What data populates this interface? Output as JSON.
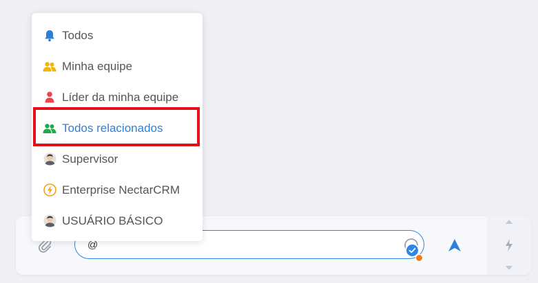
{
  "mention_menu": {
    "items": [
      {
        "label": "Todos",
        "icon": "bell-icon"
      },
      {
        "label": "Minha equipe",
        "icon": "team-icon"
      },
      {
        "label": "Líder da minha equipe",
        "icon": "leader-icon"
      },
      {
        "label": "Todos relacionados",
        "icon": "related-team-icon"
      },
      {
        "label": "Supervisor",
        "icon": "avatar-icon"
      },
      {
        "label": "Enterprise NectarCRM",
        "icon": "enterprise-icon"
      },
      {
        "label": "USUÁRIO BÁSICO",
        "icon": "avatar-icon"
      }
    ],
    "selected_index": 3
  },
  "composer": {
    "input_value": "@"
  },
  "colors": {
    "accent": "#2f7fd8",
    "highlight": "#e3101b",
    "team": "#f5b400",
    "leader": "#e8474f",
    "related": "#1faa4a"
  }
}
